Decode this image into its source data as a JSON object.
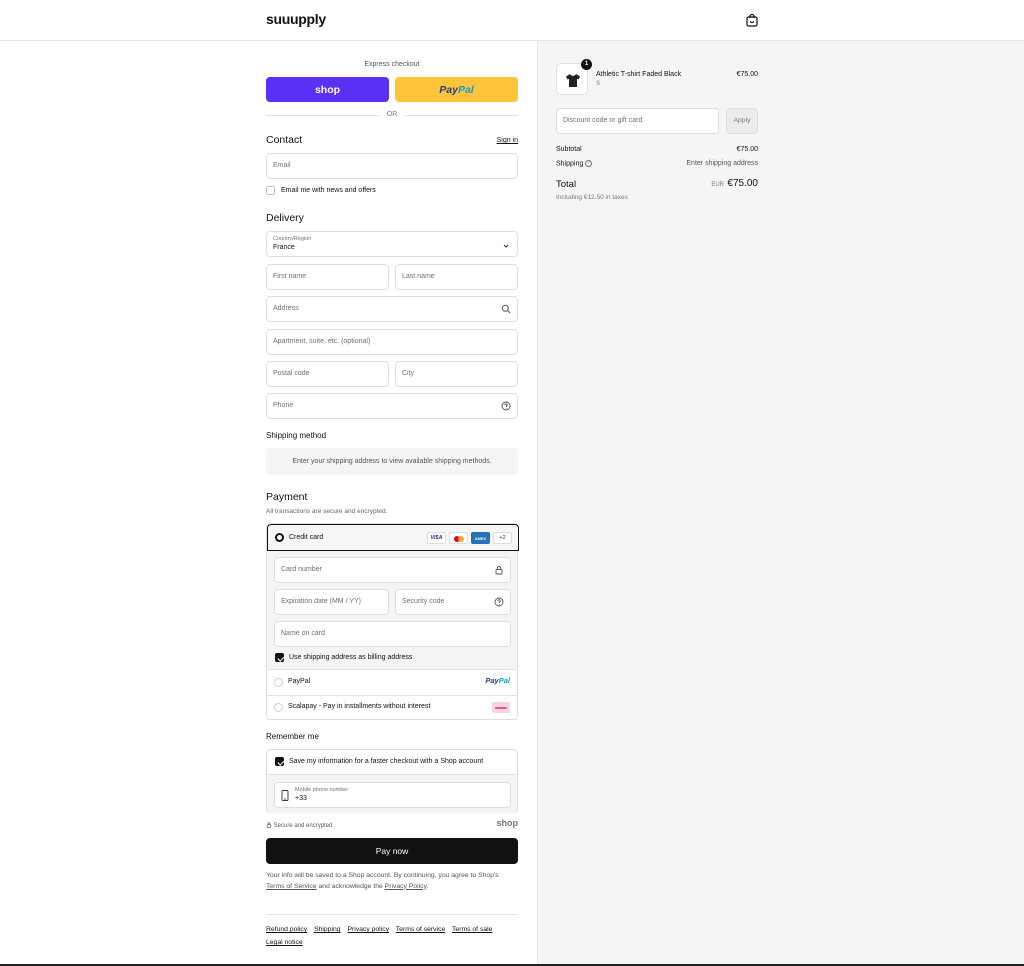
{
  "header": {
    "logo": "suuupply"
  },
  "express": {
    "label": "Express checkout",
    "shop_label": "shop",
    "paypal_a": "Pay",
    "paypal_b": "Pal",
    "or": "OR"
  },
  "contact": {
    "title": "Contact",
    "sign_in": "Sign in",
    "email_placeholder": "Email",
    "news_label": "Email me with news and offers"
  },
  "delivery": {
    "title": "Delivery",
    "country_label": "Country/Region",
    "country_value": "France",
    "first_name": "First name",
    "last_name": "Last name",
    "address": "Address",
    "apartment": "Apartment, suite, etc. (optional)",
    "postal": "Postal code",
    "city": "City",
    "phone": "Phone"
  },
  "shipping": {
    "title": "Shipping method",
    "message": "Enter your shipping address to view available shipping methods."
  },
  "payment": {
    "title": "Payment",
    "subtitle": "All transactions are secure and encrypted.",
    "credit_card": "Credit card",
    "card_logos": {
      "visa": "VISA",
      "amex": "AMEX",
      "more": "+2"
    },
    "card_number": "Card number",
    "expiration": "Expiration date (MM / YY)",
    "security": "Security code",
    "name_on_card": "Name on card",
    "billing_same": "Use shipping address as billing address",
    "paypal": "PayPal",
    "paypal_logo_a": "Pay",
    "paypal_logo_b": "Pal",
    "scalapay": "Scalapay - Pay in installments without interest"
  },
  "remember": {
    "title": "Remember me",
    "save_label": "Save my information for a faster checkout with a Shop account",
    "mobile_label": "Mobile phone number",
    "mobile_value": "+33"
  },
  "footer_area": {
    "secure": "Secure and encrypted",
    "shop": "shop",
    "pay_now": "Pay now",
    "legal_1": "Your info will be saved to a Shop account. By continuing, you agree to Shop's",
    "legal_terms": "Terms of Service",
    "legal_2": "and acknowledge the",
    "legal_privacy": "Privacy Policy",
    "legal_end": ".",
    "links": [
      "Refund policy",
      "Shipping",
      "Privacy policy",
      "Terms of service",
      "Terms of sale",
      "Legal notice"
    ]
  },
  "summary": {
    "product_name": "Athletic T-shirt Faded Black",
    "variant": "S",
    "quantity": "1",
    "price": "€75.00",
    "discount_placeholder": "Discount code or gift card",
    "apply": "Apply",
    "subtotal_label": "Subtotal",
    "subtotal_value": "€75.00",
    "shipping_label": "Shipping",
    "shipping_value": "Enter shipping address",
    "total_label": "Total",
    "currency": "EUR",
    "total_value": "€75.00",
    "taxes": "Including €12.50 in taxes"
  }
}
